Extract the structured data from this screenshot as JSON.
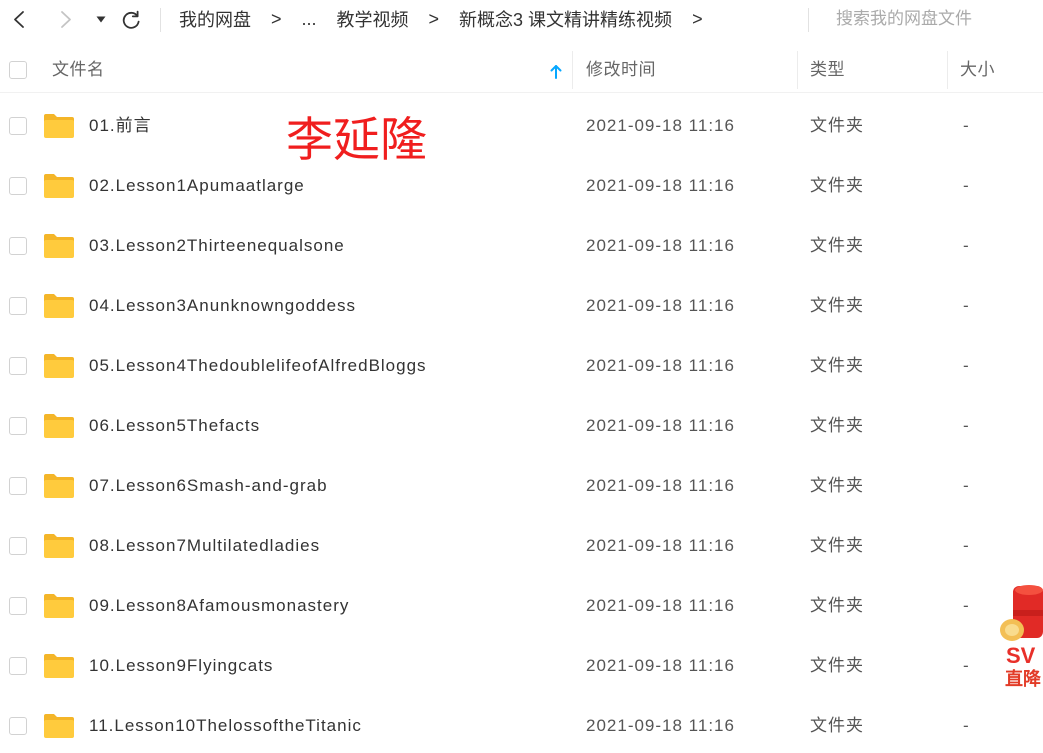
{
  "nav": {
    "back_icon": "chevron-left-icon",
    "forward_icon": "chevron-right-icon",
    "dropdown_icon": "caret-down-icon",
    "refresh_icon": "refresh-icon"
  },
  "breadcrumb": {
    "items": [
      "我的网盘",
      "...",
      "教学视频",
      "新概念3 课文精讲精练视频"
    ],
    "separator": ">"
  },
  "search": {
    "placeholder": "搜索我的网盘文件"
  },
  "table": {
    "columns": {
      "name": "文件名",
      "modified": "修改时间",
      "type": "类型",
      "size": "大小"
    },
    "sort_icon": "arrow-up-icon",
    "rows": [
      {
        "name": "01.前言",
        "modified": "2021-09-18 11:16",
        "type": "文件夹",
        "size": "-",
        "icon": "folder-icon"
      },
      {
        "name": "02.Lesson1Apumaatlarge",
        "modified": "2021-09-18 11:16",
        "type": "文件夹",
        "size": "-",
        "icon": "folder-icon"
      },
      {
        "name": "03.Lesson2Thirteenequalsone",
        "modified": "2021-09-18 11:16",
        "type": "文件夹",
        "size": "-",
        "icon": "folder-icon"
      },
      {
        "name": "04.Lesson3Anunknowngoddess",
        "modified": "2021-09-18 11:16",
        "type": "文件夹",
        "size": "-",
        "icon": "folder-icon"
      },
      {
        "name": "05.Lesson4ThedoublelifeofAlfredBloggs",
        "modified": "2021-09-18 11:16",
        "type": "文件夹",
        "size": "-",
        "icon": "folder-icon"
      },
      {
        "name": "06.Lesson5Thefacts",
        "modified": "2021-09-18 11:16",
        "type": "文件夹",
        "size": "-",
        "icon": "folder-icon"
      },
      {
        "name": "07.Lesson6Smash-and-grab",
        "modified": "2021-09-18 11:16",
        "type": "文件夹",
        "size": "-",
        "icon": "folder-icon"
      },
      {
        "name": "08.Lesson7Multilatedladies",
        "modified": "2021-09-18 11:16",
        "type": "文件夹",
        "size": "-",
        "icon": "folder-icon"
      },
      {
        "name": "09.Lesson8Afamousmonastery",
        "modified": "2021-09-18 11:16",
        "type": "文件夹",
        "size": "-",
        "icon": "folder-icon"
      },
      {
        "name": "10.Lesson9Flyingcats",
        "modified": "2021-09-18 11:16",
        "type": "文件夹",
        "size": "-",
        "icon": "folder-icon"
      },
      {
        "name": "11.Lesson10ThelossoftheTitanic",
        "modified": "2021-09-18 11:16",
        "type": "文件夹",
        "size": "-",
        "icon": "folder-icon"
      }
    ]
  },
  "watermark": "李延隆",
  "promo": {
    "line1": "SV",
    "line2": "直降"
  },
  "colors": {
    "accent": "#06a7ff",
    "text": "#333333",
    "muted": "#666666",
    "placeholder": "#aaaaaa",
    "folder": "#ffcb3d",
    "watermark": "#f01e1e",
    "promo": "#e52b2b"
  }
}
